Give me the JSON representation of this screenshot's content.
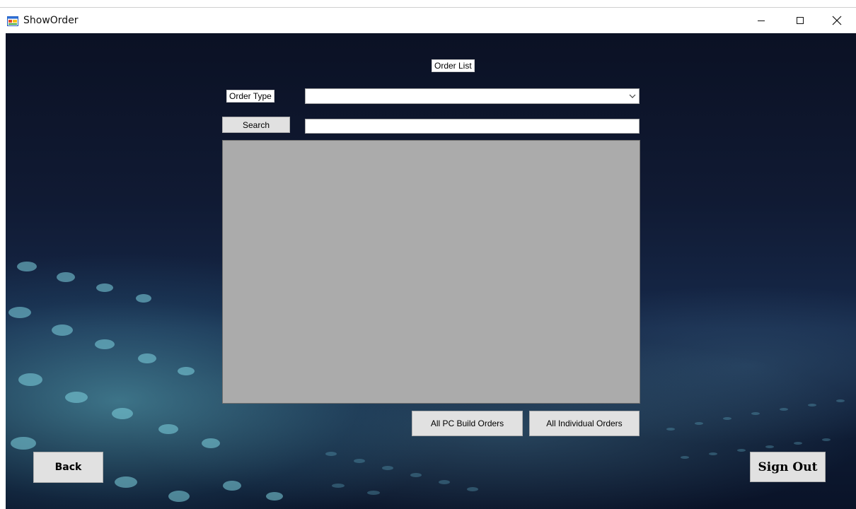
{
  "window": {
    "title": "ShowOrder",
    "controls": {
      "minimize": "minimize-icon",
      "maximize": "maximize-icon",
      "close": "close-icon"
    }
  },
  "form": {
    "heading": "Order List",
    "order_type_label": "Order Type",
    "order_type_selected": "",
    "search_button": "Search",
    "search_value": ""
  },
  "buttons": {
    "all_pc_build_orders": "All PC Build Orders",
    "all_individual_orders": "All Individual Orders",
    "back": "Back",
    "sign_out": "Sign Out"
  },
  "colors": {
    "grid_background": "#ababab",
    "button_face": "#e1e1e1"
  }
}
